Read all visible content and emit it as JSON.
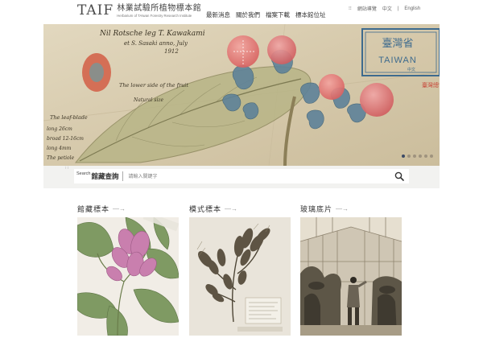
{
  "header": {
    "logo_mark": "TAIF",
    "logo_title": "林業試驗所植物標本館",
    "logo_subtitle": "Herbarium of TAIwan Forestry Research Institute",
    "nav": [
      "最新消息",
      "關於我們",
      "檔案下載",
      "標本館位址"
    ],
    "utility": {
      "sitemap": "網站導覽",
      "lang_zh": "中文",
      "lang_en": "English"
    }
  },
  "hero": {
    "specimen_text": {
      "handwriting_top": "Nil Rotsche leg T. Kawakami",
      "handwriting_top2": "et S. Sasaki  anno, July",
      "year": "1912",
      "lower_side": "The lower side of the fruit",
      "leaf_blade": "The leaf-blade",
      "dims1": "long 26cm",
      "dims2": "broad 12-16cm",
      "dims3": "long 4mm",
      "dims4": "The petiole",
      "nat_size": "Natural size",
      "stamp_zh": "臺灣省",
      "stamp_en": "TAIWAN",
      "stamp_small": "中文",
      "stamp_red": "臺灣總督府"
    },
    "slides": 6,
    "active_slide": 0
  },
  "search": {
    "prefix": "Search",
    "label": "館藏查詢",
    "placeholder": "請輸入關鍵字"
  },
  "collections": [
    {
      "title": "館藏標本",
      "arrow": "—→"
    },
    {
      "title": "模式標本",
      "arrow": "—→"
    },
    {
      "title": "玻璃底片",
      "arrow": "—→"
    }
  ],
  "colors": {
    "hero_paper": "#d8cdb1",
    "active_dot": "#3c4a66",
    "fruit_pink": "#e0726e",
    "fruit_blue": "#5a7f96",
    "stamp_blue": "#3e6b8e"
  }
}
